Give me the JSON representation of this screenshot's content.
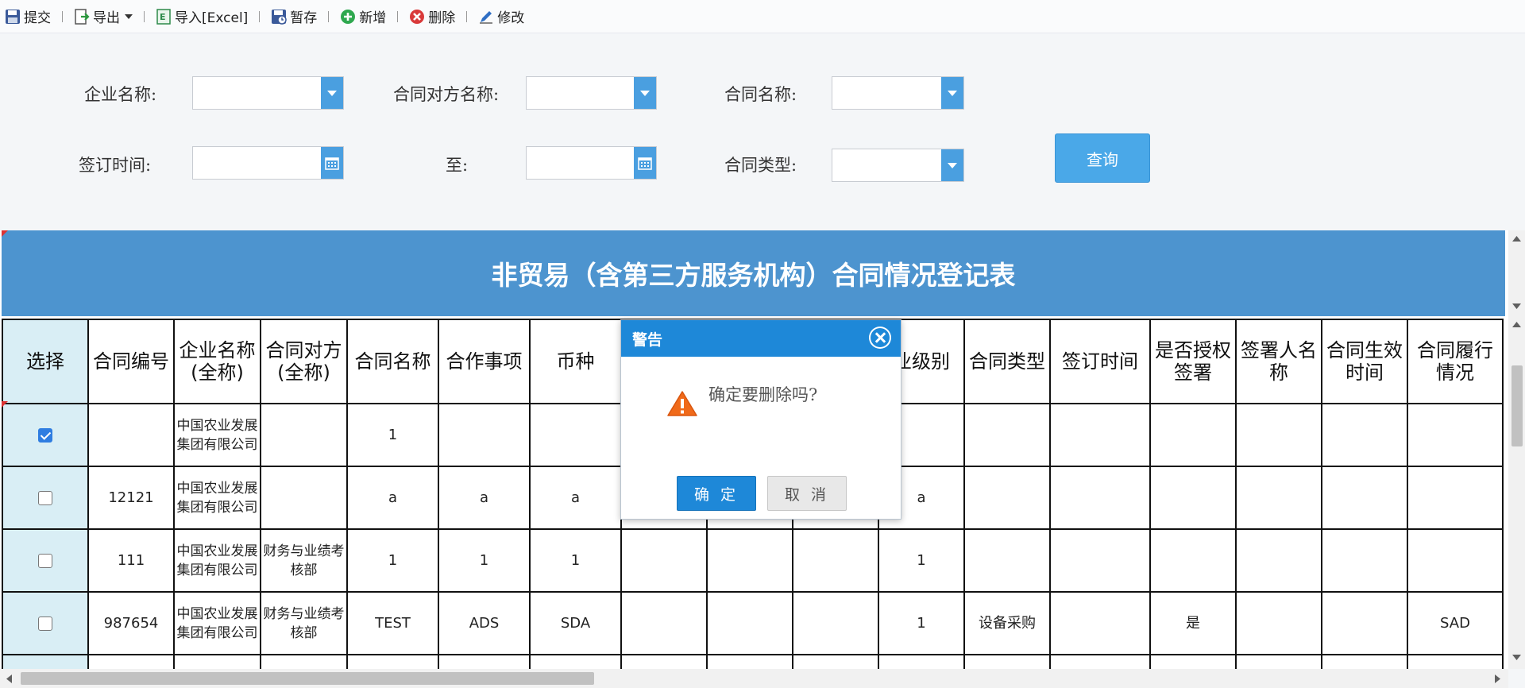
{
  "toolbar": {
    "items": [
      {
        "label": "提交",
        "icon": "save-icon"
      },
      {
        "label": "导出",
        "icon": "export-icon",
        "has_dropdown": true
      },
      {
        "label": "导入[Excel]",
        "icon": "excel-import-icon"
      },
      {
        "label": "暂存",
        "icon": "temp-save-icon"
      },
      {
        "label": "新增",
        "icon": "add-icon"
      },
      {
        "label": "删除",
        "icon": "delete-icon"
      },
      {
        "label": "修改",
        "icon": "edit-icon"
      }
    ]
  },
  "search": {
    "company_label": "企业名称:",
    "counterparty_label": "合同对方名称:",
    "contract_name_label": "合同名称:",
    "sign_date_label": "签订时间:",
    "to_label": "至:",
    "contract_type_label": "合同类型:",
    "query_label": "查询"
  },
  "grid": {
    "title": "非贸易（含第三方服务机构）合同情况登记表",
    "headers": [
      "选择",
      "合同编号",
      "企业名称(全称)",
      "合同对方(全称)",
      "合同名称",
      "合作事项",
      "币种",
      "",
      "",
      "",
      "业级别",
      "合同类型",
      "签订时间",
      "是否授权签署",
      "签署人名称",
      "合同生效时间",
      "合同履行情况"
    ],
    "rows": [
      {
        "checked": true,
        "cells": [
          "",
          "中国农业发展集团有限公司",
          "",
          "1",
          "",
          "",
          "",
          "",
          "",
          "",
          "",
          "",
          "",
          "",
          "",
          ""
        ]
      },
      {
        "checked": false,
        "cells": [
          "12121",
          "中国农业发展集团有限公司",
          "",
          "a",
          "a",
          "a",
          "",
          "",
          "",
          "a",
          "",
          "",
          "",
          "",
          "",
          ""
        ]
      },
      {
        "checked": false,
        "cells": [
          "111",
          "中国农业发展集团有限公司",
          "财务与业绩考核部",
          "1",
          "1",
          "1",
          "",
          "",
          "",
          "1",
          "",
          "",
          "",
          "",
          "",
          ""
        ]
      },
      {
        "checked": false,
        "cells": [
          "987654",
          "中国农业发展集团有限公司",
          "财务与业绩考核部",
          "TEST",
          "ADS",
          "SDA",
          "",
          "",
          "",
          "1",
          "设备采购",
          "",
          "是",
          "",
          "",
          "SAD"
        ]
      }
    ]
  },
  "dialog": {
    "title": "警告",
    "message": "确定要删除吗?",
    "ok_label": "确 定",
    "cancel_label": "取 消"
  },
  "colors": {
    "accent": "#4a9fe0",
    "title_bar": "#4d94cf",
    "dialog_header": "#1e88d8",
    "select_column": "#d9eef5"
  }
}
